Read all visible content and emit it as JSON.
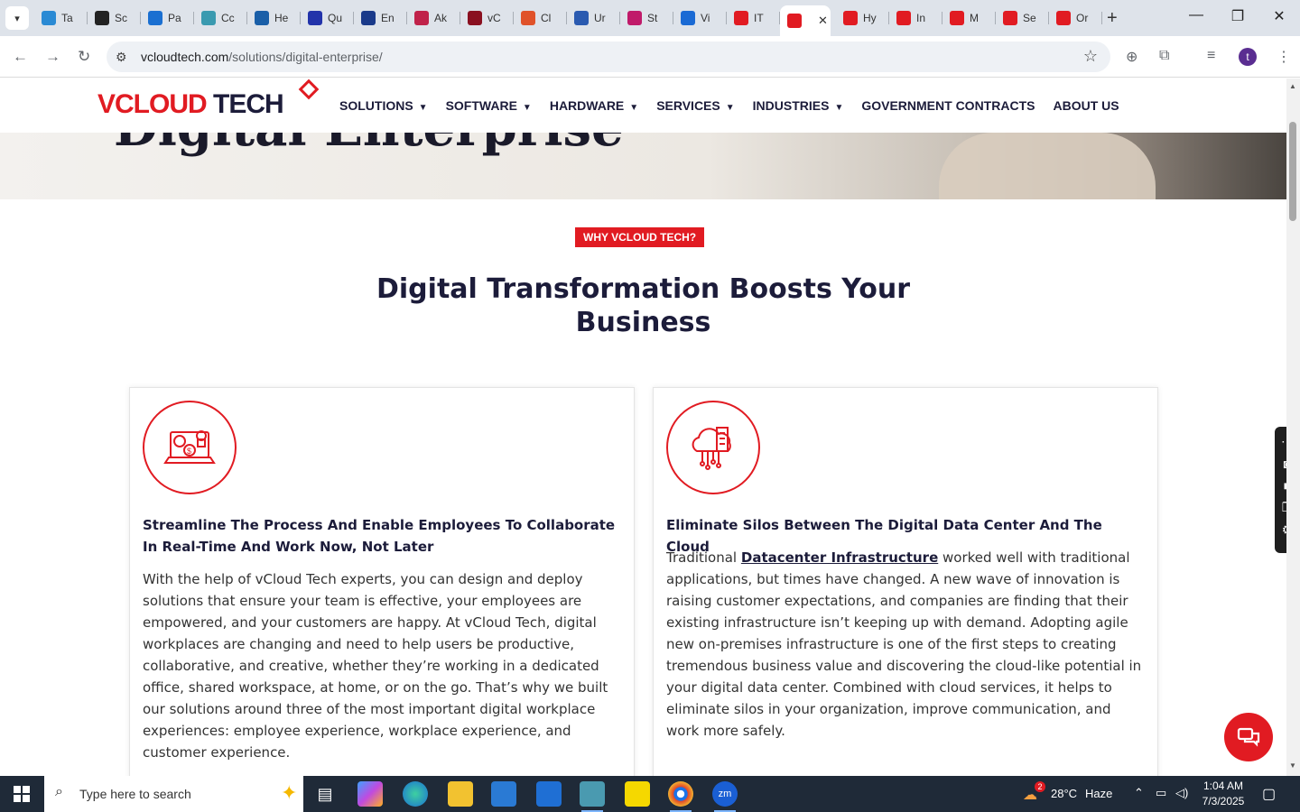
{
  "browser": {
    "tabs": [
      {
        "label": "Ta",
        "color": "#2a8ad4"
      },
      {
        "label": "Sc",
        "color": "#222222"
      },
      {
        "label": "Pa",
        "color": "#1a6fd1"
      },
      {
        "label": "Cc",
        "color": "#3a9ab0"
      },
      {
        "label": "He",
        "color": "#1a5fa8"
      },
      {
        "label": "Qu",
        "color": "#2233aa"
      },
      {
        "label": "En",
        "color": "#1a3a8a"
      },
      {
        "label": "Ak",
        "color": "#c0224a"
      },
      {
        "label": "vC",
        "color": "#8a1020"
      },
      {
        "label": "Cl",
        "color": "#e0522a"
      },
      {
        "label": "Ur",
        "color": "#2a5ab0"
      },
      {
        "label": "St",
        "color": "#c01a6a"
      },
      {
        "label": "Vi",
        "color": "#1a6ad4"
      },
      {
        "label": "IT",
        "color": "#e11b22"
      },
      {
        "label": "",
        "color": "#e11b22",
        "active": true
      },
      {
        "label": "Hy",
        "color": "#e11b22"
      },
      {
        "label": "In",
        "color": "#e11b22"
      },
      {
        "label": "M",
        "color": "#e11b22"
      },
      {
        "label": "Se",
        "color": "#e11b22"
      },
      {
        "label": "Or",
        "color": "#e11b22"
      }
    ],
    "url_domain": "vcloudtech.com",
    "url_path": "/solutions/digital-enterprise/",
    "profile_initial": "t"
  },
  "site": {
    "logo_v": "V",
    "logo_cloud": "CLOUD",
    "logo_tech": " TECH",
    "hero_title": "Digital Enterprise",
    "nav": [
      {
        "label": "SOLUTIONS",
        "dropdown": true
      },
      {
        "label": "SOFTWARE",
        "dropdown": true
      },
      {
        "label": "HARDWARE",
        "dropdown": true
      },
      {
        "label": "SERVICES",
        "dropdown": true
      },
      {
        "label": "INDUSTRIES",
        "dropdown": true
      },
      {
        "label": "GOVERNMENT CONTRACTS",
        "dropdown": false
      },
      {
        "label": "ABOUT US",
        "dropdown": false
      }
    ],
    "badge": "WHY VCLOUD TECH?",
    "section_title": "Digital Transformation Boosts Your Business",
    "card1": {
      "heading": "Streamline The Process And Enable Employees To Collaborate In Real-Time And Work Now, Not Later",
      "body": "With the help of vCloud Tech experts, you can design and deploy solutions that ensure your team is effective, your employees are empowered, and your customers are happy. At vCloud Tech, digital workplaces are changing and need to help users be productive, collaborative, and creative, whether they’re working in a dedicated office, shared workspace, at home, or on the go. That’s why we built our solutions around three of the most important digital workplace experiences: employee experience, workplace experience, and customer experience."
    },
    "card2": {
      "heading": "Eliminate Silos Between The Digital Data Center And The Cloud",
      "body_before": "Traditional ",
      "link": "Datacenter Infrastructure",
      "body_after": " worked well with traditional applications, but times have changed. A new wave of innovation is raising customer expectations, and companies are finding that their existing infrastructure isn’t keeping up with demand. Adopting agile new on-premises infrastructure is one of the first steps to creating tremendous business value and discovering the cloud-like potential in your digital data center. Combined with cloud services, it helps to eliminate silos in your organization, improve communication, and work more safely."
    },
    "accent_color": "#e11b22",
    "navy_color": "#1c1c3a"
  },
  "taskbar": {
    "search_placeholder": "Type here to search",
    "weather_temp": "28°C",
    "weather_desc": "Haze",
    "weather_badge": "2",
    "time": "1:04 AM",
    "date": "7/3/2025"
  }
}
